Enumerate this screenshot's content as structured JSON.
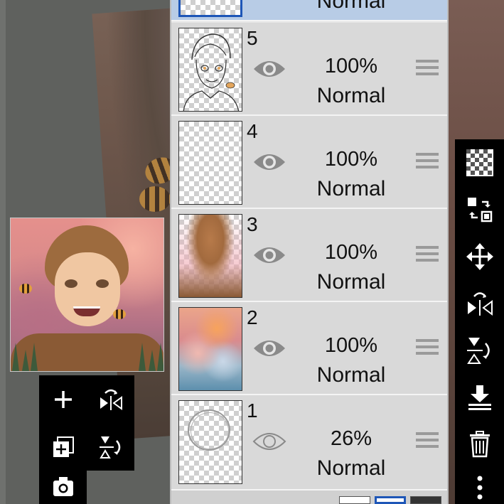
{
  "layers": [
    {
      "number": "",
      "opacity": "",
      "blend": "Normal",
      "selected": true,
      "eye": "eye-icon"
    },
    {
      "number": "5",
      "opacity": "100%",
      "blend": "Normal",
      "selected": false,
      "eye": "eye-icon"
    },
    {
      "number": "4",
      "opacity": "100%",
      "blend": "Normal",
      "selected": false,
      "eye": "eye-icon"
    },
    {
      "number": "3",
      "opacity": "100%",
      "blend": "Normal",
      "selected": false,
      "eye": "eye-icon"
    },
    {
      "number": "2",
      "opacity": "100%",
      "blend": "Normal",
      "selected": false,
      "eye": "eye-icon"
    },
    {
      "number": "1",
      "opacity": "26%",
      "blend": "Normal",
      "selected": false,
      "eye": "eye-outline-icon"
    }
  ],
  "left_tools": [
    "add-layer-icon",
    "flip-horizontal-icon",
    "add-paper-layer-icon",
    "flip-vertical-icon",
    "camera-icon"
  ],
  "right_tools": [
    "transparency-icon",
    "move-layer-icon",
    "move-icon",
    "flip-horizontal-icon",
    "flip-vertical-icon",
    "merge-down-icon",
    "trash-icon",
    "more-icon"
  ],
  "colors": {
    "selected_row": "#b8cce6",
    "row": "#d9d9d9",
    "toolbar": "#000000",
    "accent": "#1e56b7"
  }
}
